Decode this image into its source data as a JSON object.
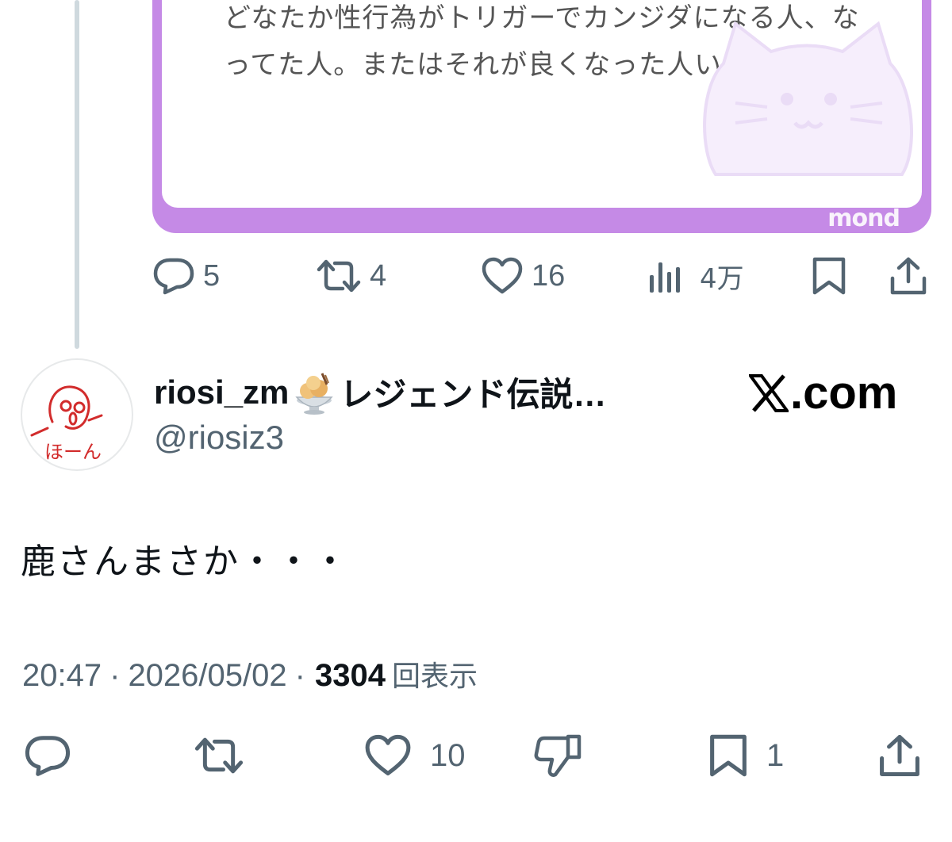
{
  "quoted_card": {
    "text": "どなたか性行為がトリガーでカンジダになる人、なってた人。またはそれが良くなった人いませんか泣",
    "brand": "mond",
    "border_color": "#c58ae6",
    "watermark_icon": "cat-face-icon"
  },
  "quoted_actions": {
    "replies": "5",
    "retweets": "4",
    "likes": "16",
    "views": "4万"
  },
  "author": {
    "display_name": "riosi_zm",
    "display_name_suffix": "レジェンド伝説…",
    "name_emoji": "ice-cream-bowl-icon",
    "handle": "@riosiz3",
    "avatar_label": "ほーん",
    "avatar_color": "#d22c2c"
  },
  "site": {
    "label": ".com"
  },
  "tweet": {
    "text": "鹿さんまさか・・・",
    "time": "20:47",
    "date": "2026/05/02",
    "separator": "·",
    "views_count": "3304",
    "views_label": "回表示"
  },
  "bottom_actions": {
    "likes": "10",
    "bookmarks": "1"
  },
  "colors": {
    "icon_gray": "#536471",
    "text": "#0f1419"
  }
}
